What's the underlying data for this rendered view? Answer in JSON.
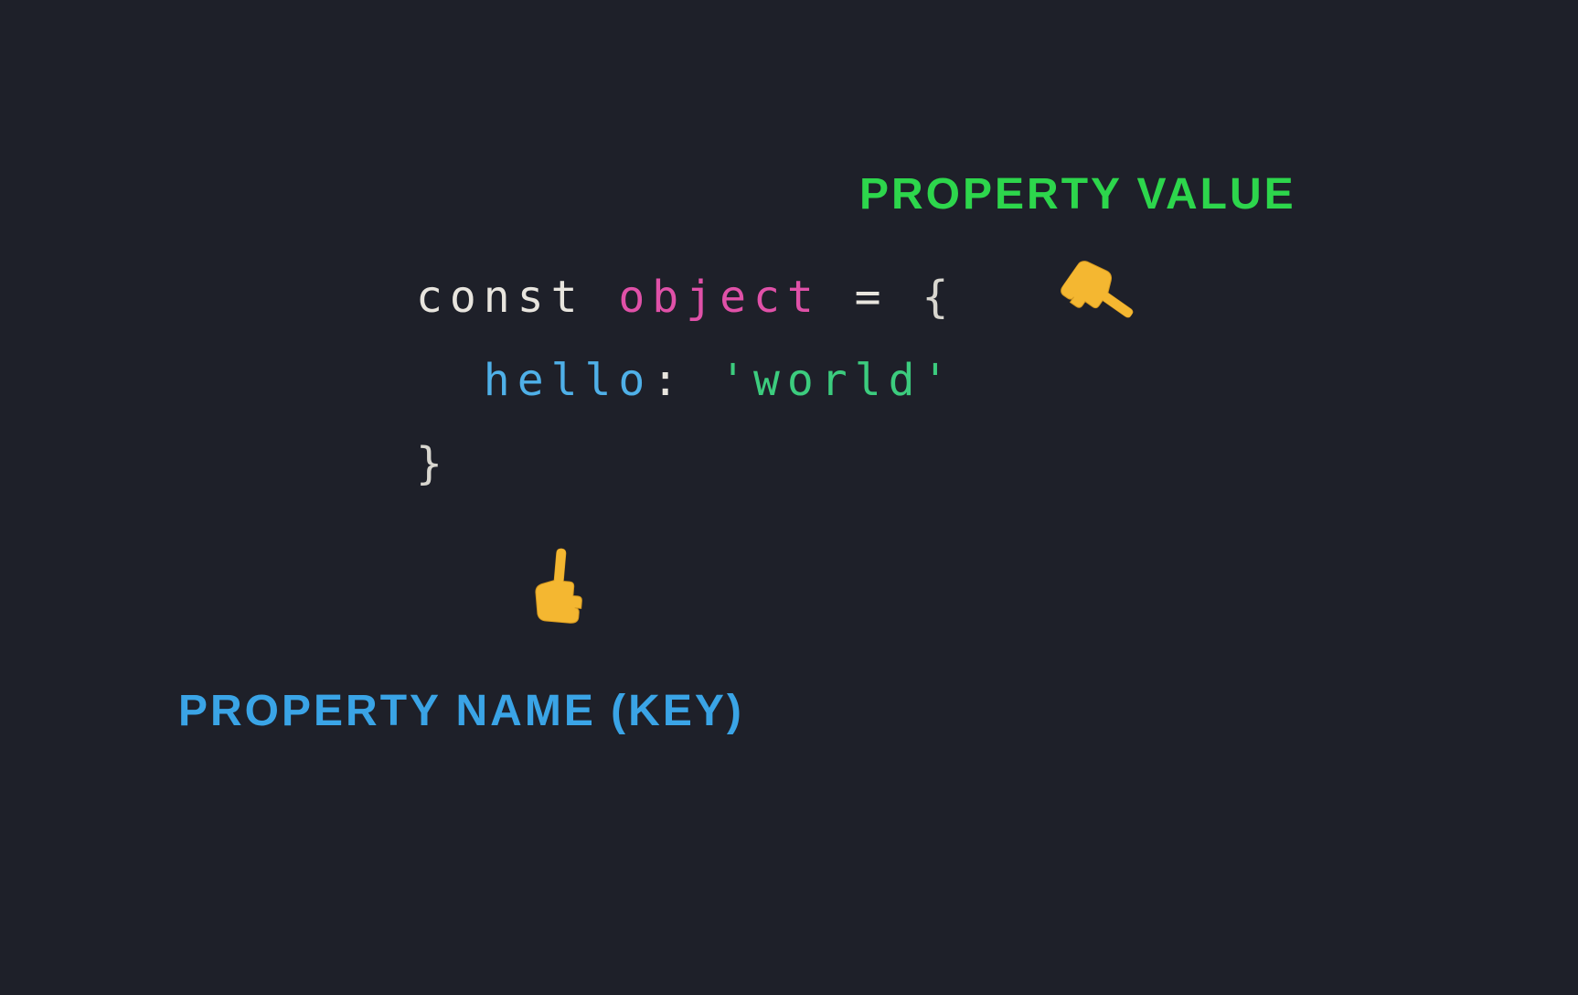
{
  "labels": {
    "property_value": "property value",
    "property_name": "property name (key)"
  },
  "code": {
    "keyword": "const ",
    "name": "object",
    "equals": " = ",
    "brace_open": "{",
    "indent": "  ",
    "key": "hello",
    "colon": ": ",
    "string": "'world'",
    "brace_close": "}"
  },
  "pointers": {
    "right": "👆",
    "up": "👆"
  }
}
